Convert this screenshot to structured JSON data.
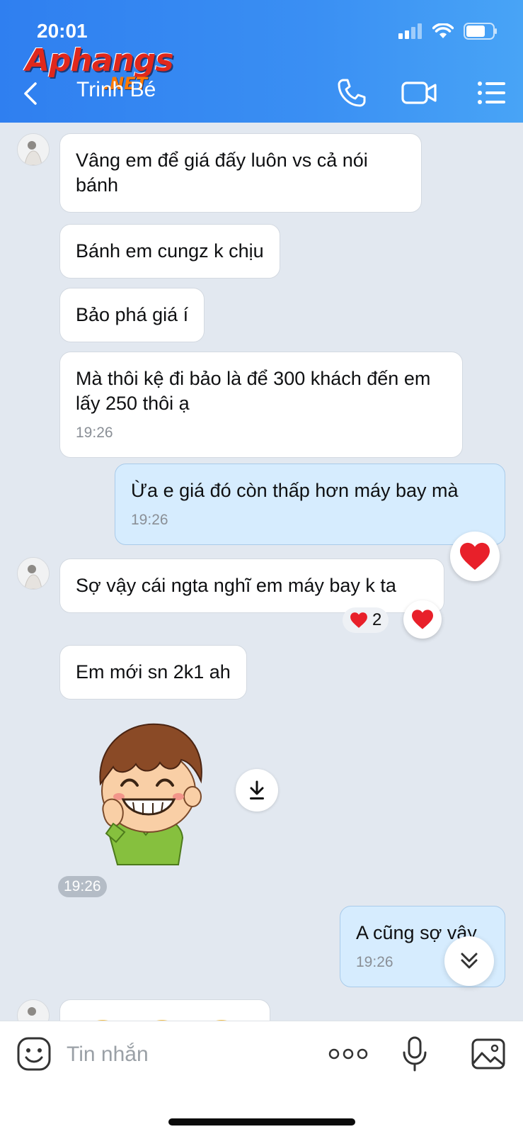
{
  "status": {
    "time": "20:01"
  },
  "watermark": {
    "text": "Aphangs",
    "suffix": ".NET"
  },
  "header": {
    "contact_name": "Trinh Bé"
  },
  "messages": [
    {
      "text": "Vâng em để giá đấy luôn vs cả nói bánh"
    },
    {
      "text": "Bánh em cungz k chịu"
    },
    {
      "text": "Bảo phá giá í"
    },
    {
      "text": "Mà thôi kệ đi bảo là để 300 khách đến em lấy 250 thôi ạ",
      "time": "19:26"
    },
    {
      "text": "Ừa e giá đó còn thấp hơn máy bay mà",
      "time": "19:26",
      "reaction": "heart"
    },
    {
      "text": "Sợ vậy cái ngta nghĩ em máy bay k ta",
      "reaction_count": "2",
      "reaction": "heart"
    },
    {
      "text": "Em mới sn 2k1 ah"
    },
    {
      "sticker": "smiling-boy-sticker",
      "time": "19:26"
    },
    {
      "text": "A cũng sợ vậy",
      "time": "19:26"
    }
  ],
  "input": {
    "placeholder": "Tin nhắn"
  },
  "colors": {
    "header": "#3a8ff3",
    "outgoing_bubble": "#d6ecfe",
    "heart": "#e8202a"
  }
}
